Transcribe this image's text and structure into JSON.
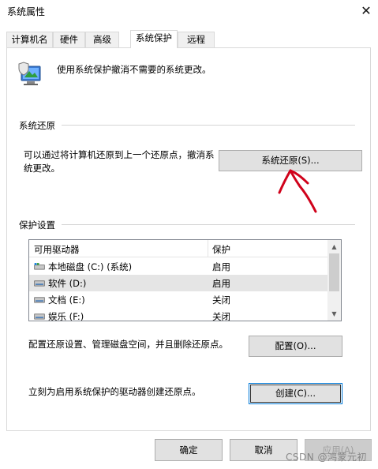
{
  "window": {
    "title": "系统属性",
    "close_glyph": "✕"
  },
  "tabs": [
    {
      "label": "计算机名",
      "active": false
    },
    {
      "label": "硬件",
      "active": false
    },
    {
      "label": "高级",
      "active": false
    },
    {
      "label": "系统保护",
      "active": true
    },
    {
      "label": "远程",
      "active": false
    }
  ],
  "header": {
    "description": "使用系统保护撤消不需要的系统更改。",
    "icon": "shield-computer-icon"
  },
  "system_restore": {
    "group_label": "系统还原",
    "text": "可以通过将计算机还原到上一个还原点，撤消系统更改。",
    "button_label": "系统还原(S)..."
  },
  "protection": {
    "group_label": "保护设置",
    "columns": [
      "可用驱动器",
      "保护"
    ],
    "rows": [
      {
        "name": "本地磁盘 (C:) (系统)",
        "status": "启用",
        "icon": "system-drive-icon",
        "selected": false
      },
      {
        "name": "软件 (D:)",
        "status": "启用",
        "icon": "drive-icon",
        "selected": true
      },
      {
        "name": "文档 (E:)",
        "status": "关闭",
        "icon": "drive-icon",
        "selected": false
      },
      {
        "name": "娱乐 (F:)",
        "status": "关闭",
        "icon": "drive-icon",
        "selected": false
      }
    ],
    "configure_text": "配置还原设置、管理磁盘空间，并且删除还原点。",
    "configure_button": "配置(O)...",
    "create_text": "立刻为启用系统保护的驱动器创建还原点。",
    "create_button": "创建(C)..."
  },
  "footer": {
    "ok": "确定",
    "cancel": "取消",
    "apply": "应用(A)"
  },
  "annotation": {
    "color": "#d0021b"
  },
  "watermark": "CSDN @鸿蒙元初"
}
